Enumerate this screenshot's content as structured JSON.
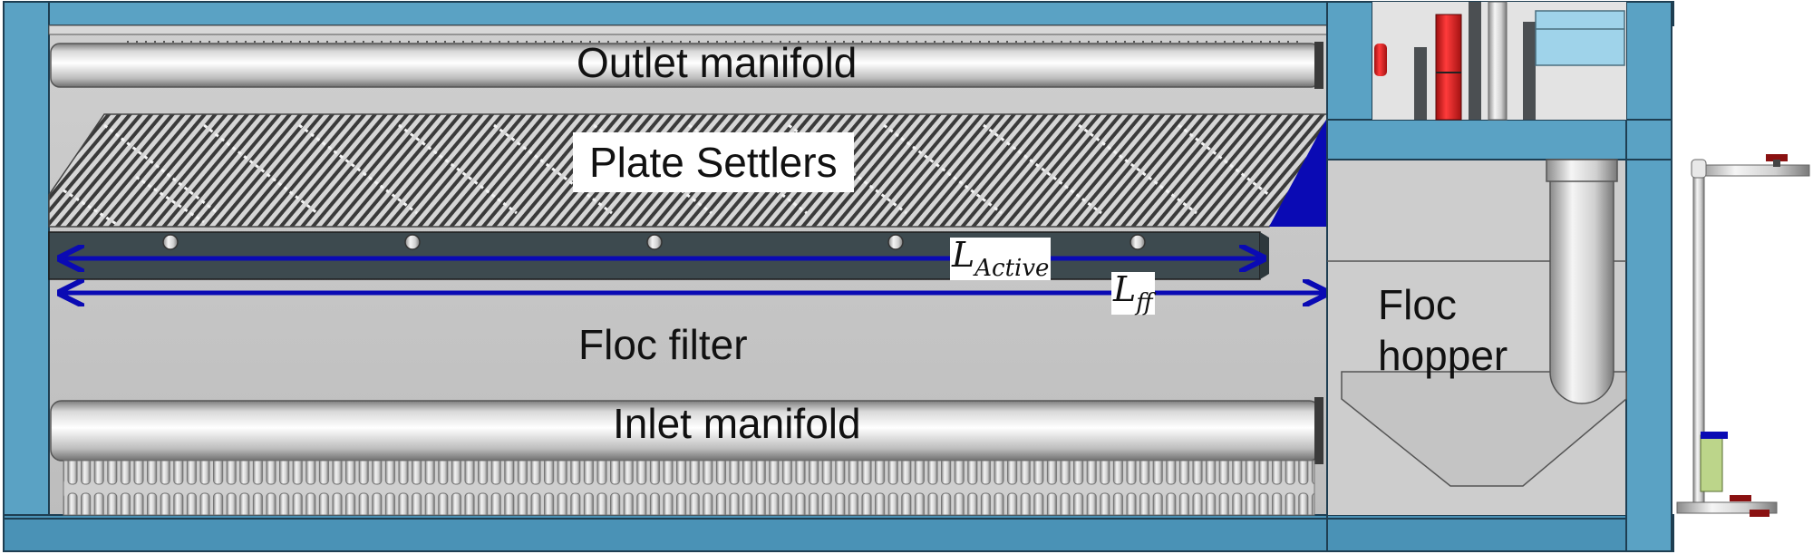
{
  "diagram": {
    "labels": {
      "outlet_manifold": "Outlet manifold",
      "plate_settlers": "Plate Settlers",
      "floc_filter": "Floc filter",
      "inlet_manifold": "Inlet manifold",
      "floc_hopper_line1": "Floc",
      "floc_hopper_line2": "hopper"
    },
    "dimensions": {
      "l_active": {
        "symbol": "L",
        "subscript": "Active"
      },
      "l_ff": {
        "symbol": "L",
        "subscript": "ff"
      }
    },
    "colors": {
      "tank_frame": "#5aa2c4",
      "tank_frame_dark": "#3b7fa3",
      "tank_interior": "#c9c9c9",
      "pipe_light": "#f2f2f2",
      "pipe_shadow": "#8f8f8f",
      "plate_dark": "#3a3a3a",
      "support_beam": "#3d4a4f",
      "dimension_arrow": "#0a0ab4",
      "valve_red": "#d11919",
      "light_blue_box": "#9fd3ea"
    }
  }
}
